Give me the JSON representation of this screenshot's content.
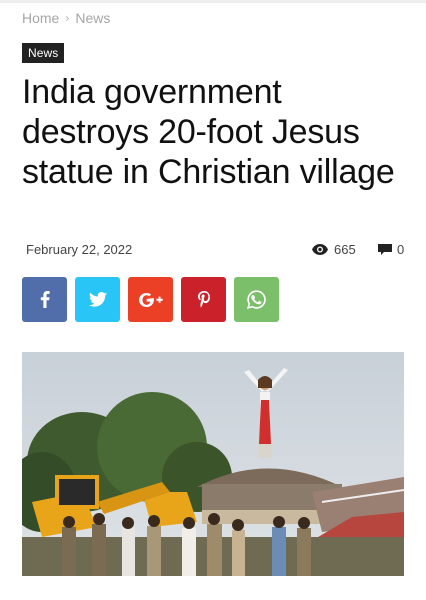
{
  "breadcrumb": {
    "home": "Home",
    "separator": "›",
    "current": "News"
  },
  "category": "News",
  "article": {
    "title": "India government destroys 20-foot Jesus statue in Christian village",
    "date": "February 22, 2022",
    "views": "665",
    "comments": "0"
  },
  "share": [
    {
      "network": "facebook",
      "icon": "facebook-icon",
      "color": "#516eab"
    },
    {
      "network": "twitter",
      "icon": "twitter-icon",
      "color": "#29c5f6"
    },
    {
      "network": "google-plus",
      "icon": "google-plus-icon",
      "color": "#eb4026"
    },
    {
      "network": "pinterest",
      "icon": "pinterest-icon",
      "color": "#ca212a"
    },
    {
      "network": "whatsapp",
      "icon": "whatsapp-icon",
      "color": "#7bbf6a"
    }
  ],
  "meta_icons": {
    "views": "eye-icon",
    "comments": "comment-icon"
  }
}
